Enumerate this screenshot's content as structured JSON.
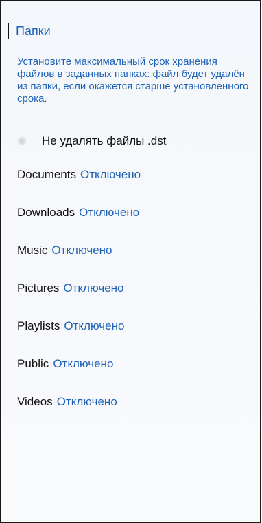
{
  "header": {
    "title": "Папки"
  },
  "description": "Установите максимальный срок хранения файлов в заданных папках: файл будет удалён из папки, если окажется старше установленного срока.",
  "toggle": {
    "label": "Не удалять файлы .dst"
  },
  "folders": [
    {
      "name": "Documents",
      "status": "Отключено"
    },
    {
      "name": "Downloads",
      "status": "Отключено"
    },
    {
      "name": "Music",
      "status": "Отключено"
    },
    {
      "name": "Pictures",
      "status": "Отключено"
    },
    {
      "name": "Playlists",
      "status": "Отключено"
    },
    {
      "name": "Public",
      "status": "Отключено"
    },
    {
      "name": "Videos",
      "status": "Отключено"
    }
  ],
  "colors": {
    "accent": "#1f63b8",
    "text": "#111111",
    "border": "#1a1a1a"
  }
}
